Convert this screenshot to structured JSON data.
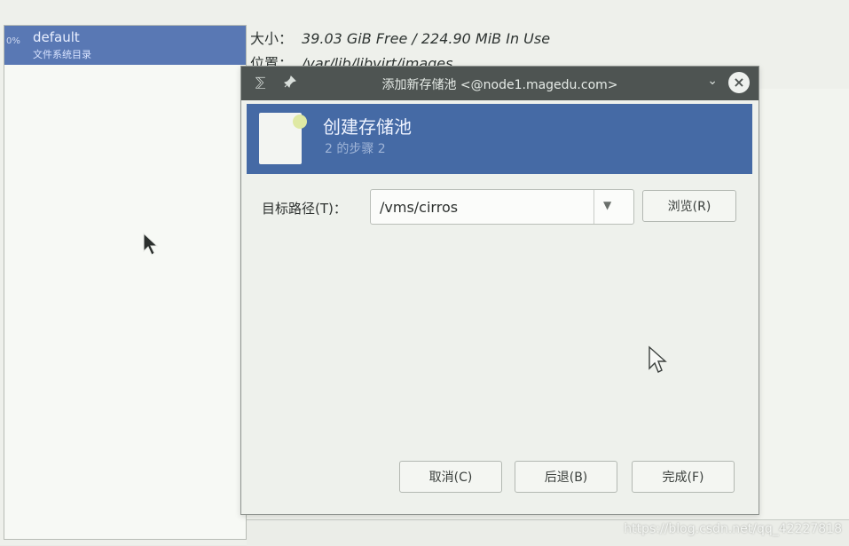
{
  "left_pane": {
    "pools": [
      {
        "prefix": "0%",
        "name": "default",
        "type": "文件系统目录"
      }
    ]
  },
  "details": {
    "size_label": "大小：",
    "size_value": "39.03 GiB Free / 224.90 MiB In Use",
    "location_label": "位置：",
    "location_value": "/var/lib/libvirt/images"
  },
  "dialog": {
    "titlebar": {
      "title": "添加新存储池 <@node1.magedu.com>",
      "left_icon": "⅀",
      "pin_icon": "pin-icon",
      "minimize_glyph": "⌄",
      "close_glyph": "×"
    },
    "banner": {
      "title": "创建存储池",
      "step": "2 的步骤 2"
    },
    "target": {
      "label": "目标路径(T)：",
      "value": "/vms/cirros"
    },
    "browse_label": "浏览(R)",
    "buttons": {
      "cancel": "取消(C)",
      "back": "后退(B)",
      "finish": "完成(F)"
    }
  },
  "watermark": "https://blog.csdn.net/qq_42227818",
  "colors": {
    "selection": "#5978b4",
    "banner": "#456aa5",
    "titlebar": "#4e5452"
  }
}
